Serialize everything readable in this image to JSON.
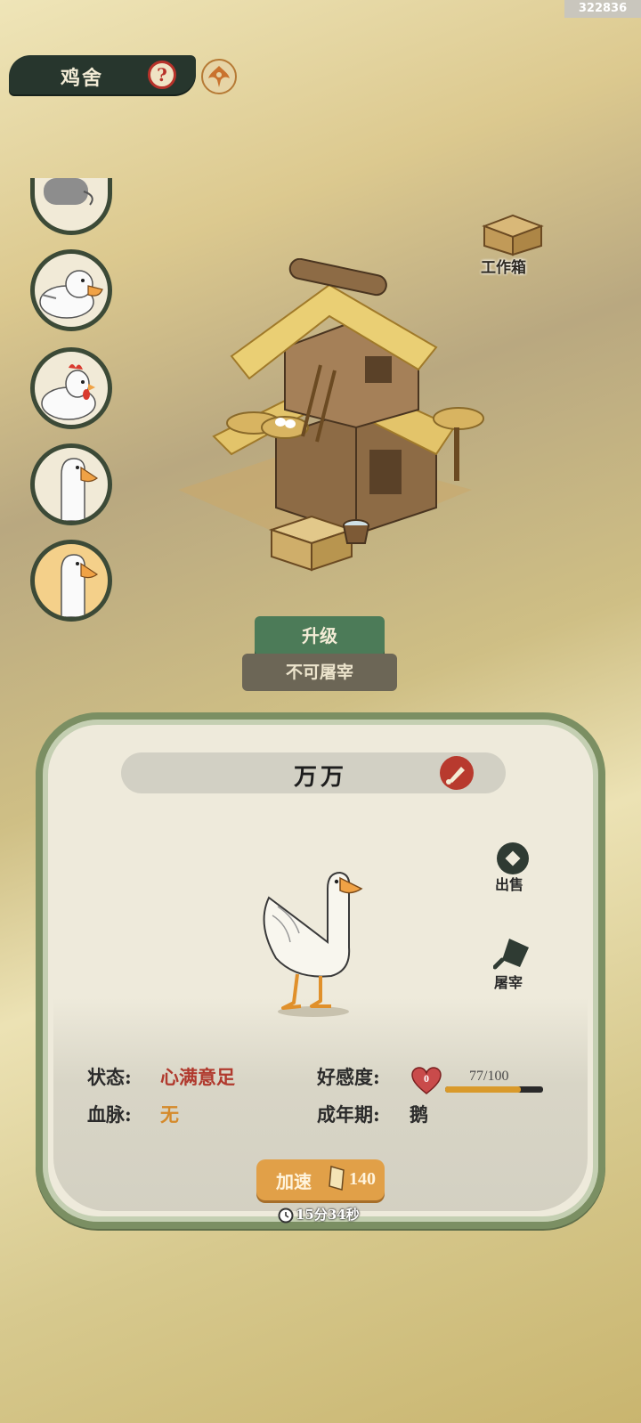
{
  "header": {
    "title": "鸡舍",
    "help_symbol": "?"
  },
  "watermark": "322836",
  "workbox": {
    "label": "工作箱"
  },
  "avatars": [
    {
      "animal": "goose",
      "partial": true
    },
    {
      "animal": "duck"
    },
    {
      "animal": "chicken"
    },
    {
      "animal": "goose"
    },
    {
      "animal": "goose",
      "selected": true
    }
  ],
  "actions": {
    "upgrade": "升级",
    "no_slaughter": "不可屠宰"
  },
  "panel": {
    "name": "万万",
    "sell_label": "出售",
    "slaughter_label": "屠宰",
    "status_label": "状态:",
    "status_value": "心满意足",
    "bloodline_label": "血脉:",
    "bloodline_value": "无",
    "affection_label": "好感度:",
    "affection_level": "0",
    "affection_text": "77/100",
    "affection_fraction": 0.77,
    "adult_label": "成年期:",
    "adult_value": "鹅",
    "speed_label": "加速",
    "speed_cost": "140",
    "timer": "15分34秒"
  },
  "colors": {
    "accent_green": "#4c7b58",
    "status_red": "#b0392d",
    "bloodline_orange": "#d58a2b",
    "speed_orange": "#e1a048"
  }
}
